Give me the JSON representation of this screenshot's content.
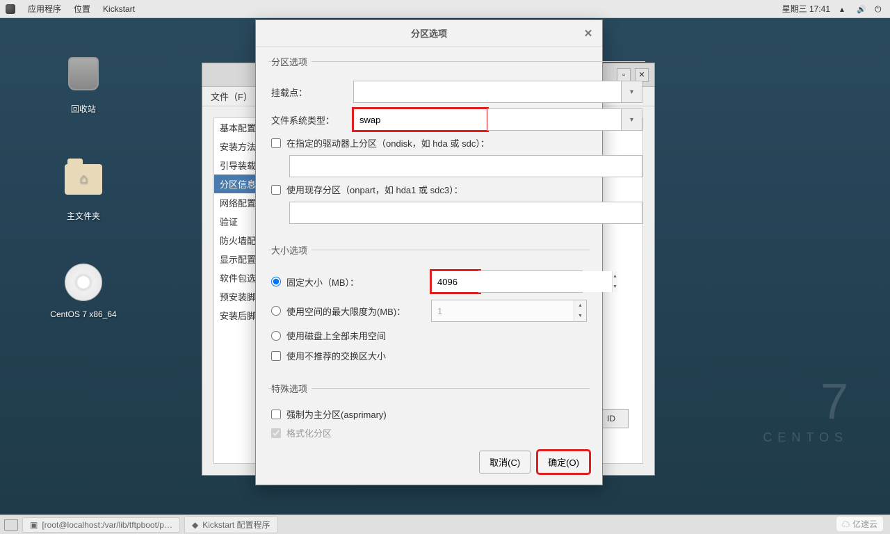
{
  "panel": {
    "apps": "应用程序",
    "places": "位置",
    "appname": "Kickstart",
    "datetime": "星期三 17:41"
  },
  "desktop": {
    "trash": "回收站",
    "home": "主文件夹",
    "disc": "CentOS 7 x86_64"
  },
  "centos": {
    "seven": "7",
    "name": "CENTOS"
  },
  "kswin": {
    "file_menu": "文件（F）",
    "sidebar": [
      "基本配置",
      "安装方法",
      "引导装载",
      "分区信息",
      "网络配置",
      "验证",
      "防火墙配",
      "显示配置",
      "软件包选",
      "预安装脚",
      "安装后脚"
    ],
    "selected_index": 3,
    "raid_btn": "ID"
  },
  "dialog": {
    "title": "分区选项",
    "sec_partition": "分区选项",
    "mount_label": "挂载点：",
    "mount_value": "",
    "fstype_label": "文件系统类型：",
    "fstype_value": "swap",
    "ondisk_label": "在指定的驱动器上分区（ondisk，如 hda 或 sdc）：",
    "ondisk_value": "",
    "onpart_label": "使用现存分区（onpart，如 hda1 或 sdc3）：",
    "onpart_value": "",
    "sec_size": "大小选项",
    "fixed_label": "固定大小（MB）：",
    "fixed_value": "4096",
    "max_label": "使用空间的最大限度为(MB)：",
    "max_value": "1",
    "grow_label": "使用磁盘上全部未用空间",
    "recswap_label": "使用不推荐的交换区大小",
    "sec_special": "特殊选项",
    "asprimary_label": "强制为主分区(asprimary)",
    "format_label": "格式化分区",
    "cancel": "取消(C)",
    "ok": "确定(O)"
  },
  "taskbar": {
    "term": "[root@localhost:/var/lib/tftpboot/p…",
    "kick": "Kickstart 配置程序"
  },
  "watermark": "亿速云"
}
